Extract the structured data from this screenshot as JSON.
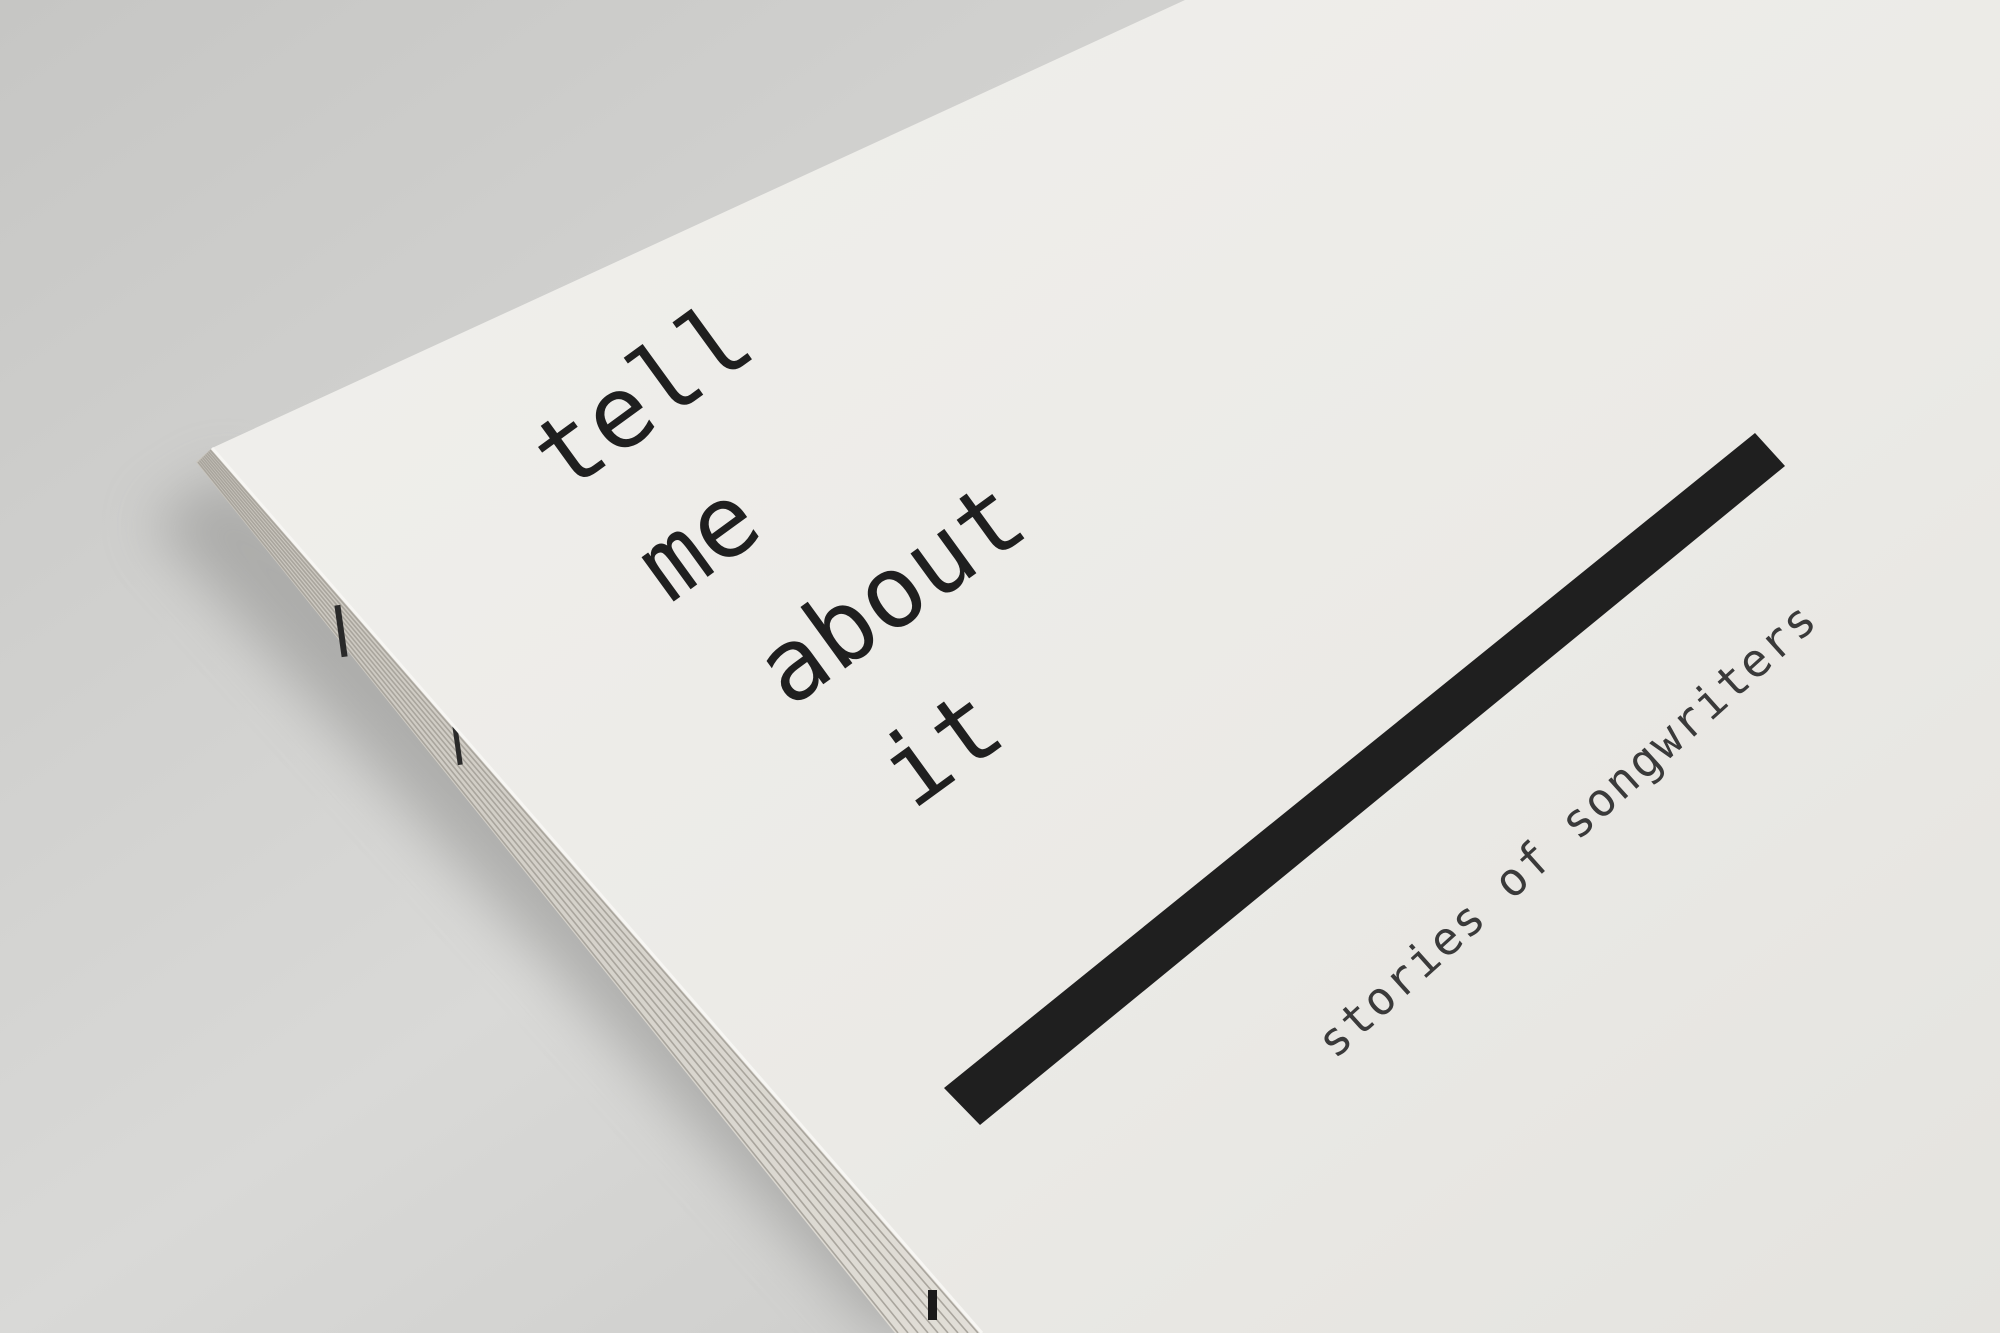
{
  "book": {
    "title_lines": [
      "tell",
      "me",
      "about",
      "it"
    ],
    "subtitle": "stories of songwriters"
  },
  "colors": {
    "background": "#d2d2d0",
    "cover": "#ecebe8",
    "ink": "#1f1f1f",
    "page_edges": "#d9d6cf"
  }
}
